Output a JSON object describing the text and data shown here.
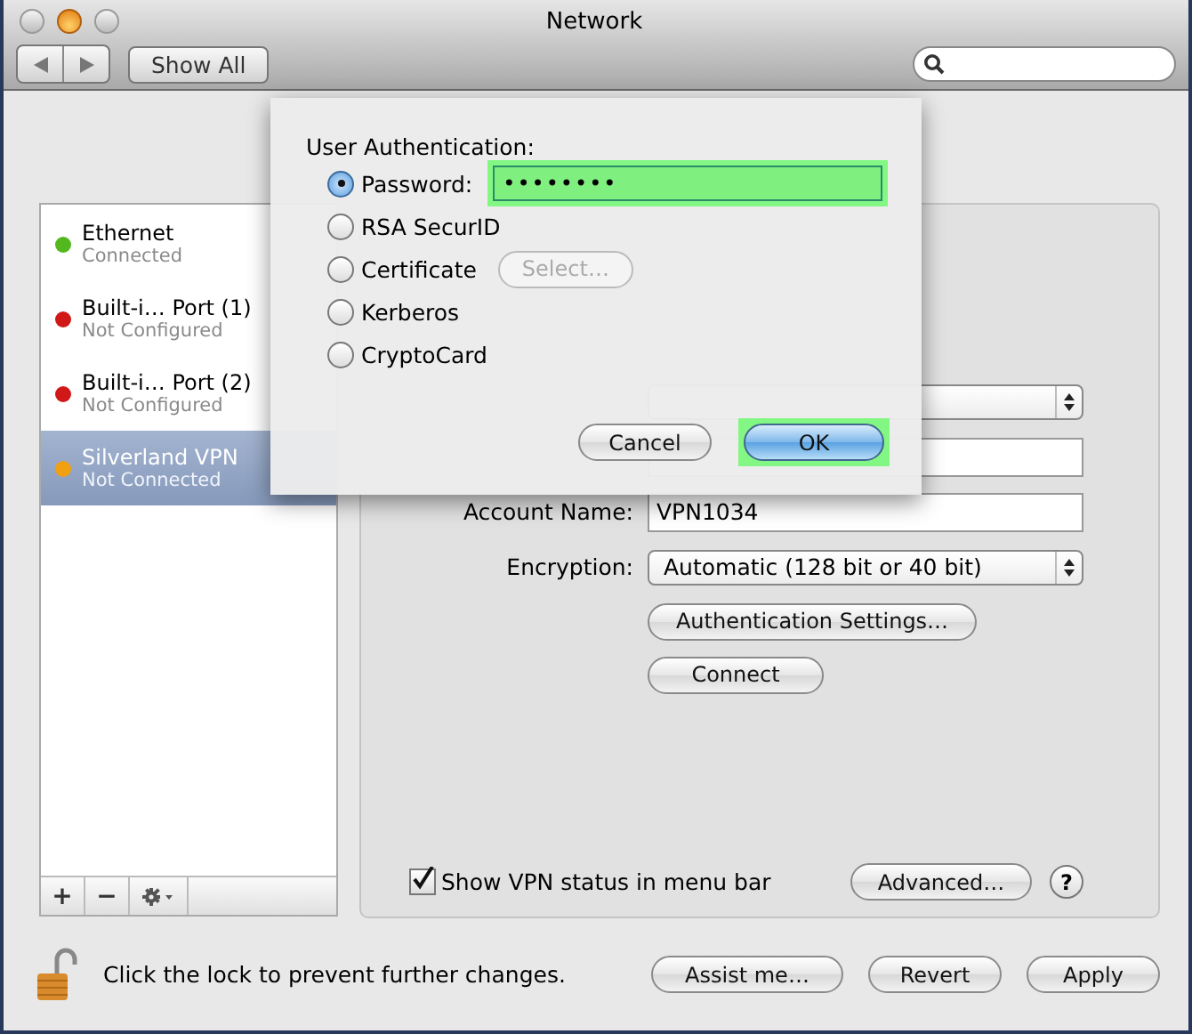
{
  "window": {
    "title": "Network"
  },
  "toolbar": {
    "show_all": "Show All"
  },
  "sidebar": {
    "items": [
      {
        "name": "Ethernet",
        "status": "Connected",
        "color": "#52b81e",
        "selected": false
      },
      {
        "name": "Built-i… Port (1)",
        "status": "Not Configured",
        "color": "#d01818",
        "selected": false
      },
      {
        "name": "Built-i… Port (2)",
        "status": "Not Configured",
        "color": "#d01818",
        "selected": false
      },
      {
        "name": "Silverland VPN",
        "status": "Not Connected",
        "color": "#f0a010",
        "selected": true
      }
    ],
    "buttons": [
      "+",
      "−"
    ]
  },
  "panel": {
    "fields": [
      {
        "kind": "text",
        "label": "Account Name:",
        "value": "VPN1034"
      },
      {
        "kind": "popup",
        "label": "Encryption:",
        "value": "Automatic (128 bit or 40 bit)"
      }
    ],
    "buttons": [
      "Authentication Settings…",
      "Connect"
    ],
    "checkbox": {
      "label": "Show VPN status in menu bar",
      "checked": true
    },
    "advanced": "Advanced…",
    "help": "?"
  },
  "footer": {
    "lock_text": "Click the lock to prevent further changes.",
    "buttons": [
      "Assist me…",
      "Revert",
      "Apply"
    ]
  },
  "sheet": {
    "title": "User Authentication:",
    "options": [
      {
        "label": "Password:",
        "selected": true,
        "kind": "field",
        "value": "••••••••",
        "highlighted": true
      },
      {
        "label": "RSA SecurID",
        "selected": false,
        "kind": "plain"
      },
      {
        "label": "Certificate",
        "selected": false,
        "kind": "button",
        "button": "Select…",
        "disabled": true
      },
      {
        "label": "Kerberos",
        "selected": false,
        "kind": "plain"
      },
      {
        "label": "CryptoCard",
        "selected": false,
        "kind": "plain"
      }
    ],
    "buttons": [
      {
        "label": "Cancel",
        "default": false,
        "highlighted": false
      },
      {
        "label": "OK",
        "default": true,
        "highlighted": true
      }
    ]
  }
}
